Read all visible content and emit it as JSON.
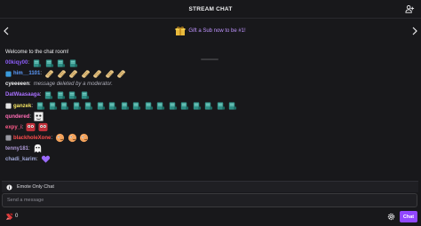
{
  "header": {
    "title": "STREAM CHAT",
    "users_icon": "users-icon"
  },
  "sub_banner": {
    "text": "Gift a Sub now to be #1!",
    "gift_icon": "gift-icon"
  },
  "chat": {
    "welcome": "Welcome to the chat room!",
    "messages": [
      {
        "user": "00kiqy00",
        "color": "#8b5cf6",
        "badge": null,
        "emote": "scroll",
        "emote_count": 4,
        "text": null
      },
      {
        "user": "him__1101",
        "color": "#5c9cff",
        "badge": "blue-badge",
        "emote": "bread",
        "emote_count": 7,
        "text": null
      },
      {
        "user": "cyeeeeen",
        "color": "#efeff1",
        "badge": null,
        "emote": null,
        "emote_count": 0,
        "text": "message deleted by a moderator."
      },
      {
        "user": "DatWaasaaga",
        "color": "#a970ff",
        "badge": null,
        "emote": "scroll",
        "emote_count": 4,
        "text": null
      },
      {
        "user": "ganzek",
        "color": "#f5e462",
        "badge": "white-badge",
        "emote": "scroll",
        "emote_count": 17,
        "text": null
      },
      {
        "user": "qundered",
        "color": "#ff6cb5",
        "badge": null,
        "emote": "face",
        "emote_count": 1,
        "text": null
      },
      {
        "user": "expy_i",
        "color": "#ff5c8a",
        "badge": null,
        "emote": "mask",
        "emote_count": 2,
        "text": null
      },
      {
        "user": "blackholeXone",
        "color": "#ff4d4d",
        "badge": "gray-badge",
        "emote": "peek",
        "emote_count": 3,
        "text": null
      },
      {
        "user": "tenny181",
        "color": "#b19cd9",
        "badge": null,
        "emote": "ghost",
        "emote_count": 1,
        "text": null
      },
      {
        "user": "chadi_karim",
        "color": "#a0a8d8",
        "badge": null,
        "emote": "heart",
        "emote_count": 1,
        "text": null
      }
    ]
  },
  "notice": {
    "text": "Emote Only Chat",
    "icon": "info-icon"
  },
  "input": {
    "placeholder": "Send a message"
  },
  "footer": {
    "bits_count": "0",
    "bits_icon": "bits-icon",
    "settings_icon": "gear-icon",
    "chat_button": "Chat"
  },
  "colors": {
    "accent": "#9147ff",
    "background": "#18181b"
  }
}
